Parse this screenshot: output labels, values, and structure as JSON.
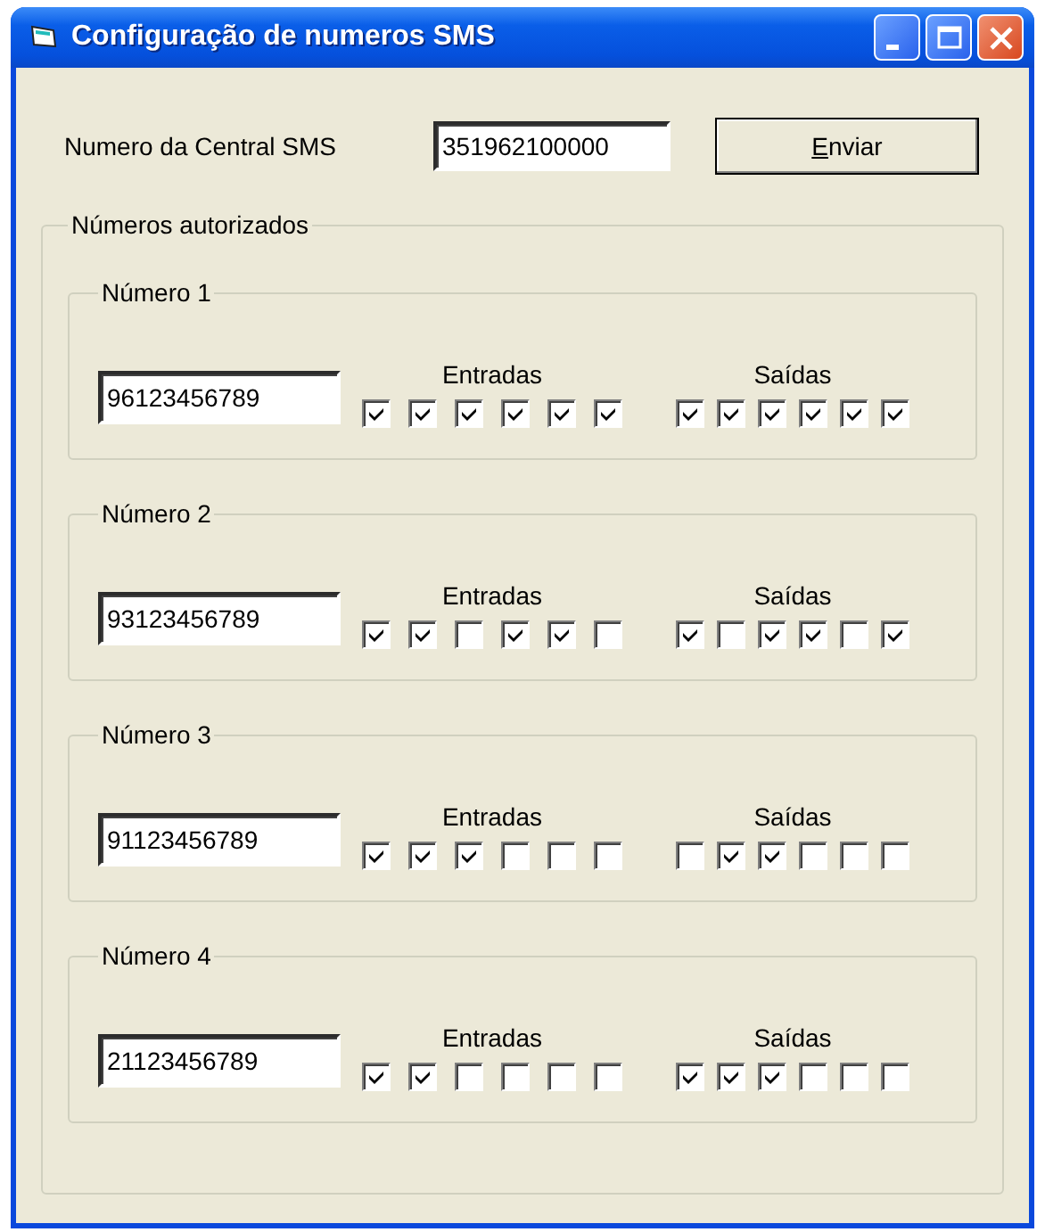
{
  "window": {
    "title": "Configuração de numeros SMS"
  },
  "central": {
    "label": "Numero da Central SMS",
    "value": "351962100000",
    "button": "Enviar"
  },
  "authorized": {
    "title": "Números autorizados",
    "groups": [
      {
        "title": "Número 1",
        "number": "96123456789",
        "columns": [
          {
            "label": "Entradas",
            "checkboxes": [
              {
                "checked": true
              },
              {
                "checked": true
              },
              {
                "checked": true
              },
              {
                "checked": true
              },
              {
                "checked": true
              },
              {
                "checked": true
              }
            ]
          },
          {
            "label": "Saídas",
            "checkboxes": [
              {
                "checked": true
              },
              {
                "checked": true
              },
              {
                "checked": true
              },
              {
                "checked": true
              },
              {
                "checked": true
              },
              {
                "checked": true
              }
            ]
          }
        ]
      },
      {
        "title": "Número 2",
        "number": "93123456789",
        "columns": [
          {
            "label": "Entradas",
            "checkboxes": [
              {
                "checked": true
              },
              {
                "checked": true
              },
              {
                "checked": false
              },
              {
                "checked": true
              },
              {
                "checked": true
              },
              {
                "checked": false
              }
            ]
          },
          {
            "label": "Saídas",
            "checkboxes": [
              {
                "checked": true
              },
              {
                "checked": false
              },
              {
                "checked": true
              },
              {
                "checked": true
              },
              {
                "checked": false
              },
              {
                "checked": true
              }
            ]
          }
        ]
      },
      {
        "title": "Número 3",
        "number": "91123456789",
        "columns": [
          {
            "label": "Entradas",
            "checkboxes": [
              {
                "checked": true
              },
              {
                "checked": true
              },
              {
                "checked": true
              },
              {
                "checked": false
              },
              {
                "checked": false
              },
              {
                "checked": false
              }
            ]
          },
          {
            "label": "Saídas",
            "checkboxes": [
              {
                "checked": false
              },
              {
                "checked": true
              },
              {
                "checked": true
              },
              {
                "checked": false
              },
              {
                "checked": false
              },
              {
                "checked": false
              }
            ]
          }
        ]
      },
      {
        "title": "Número 4",
        "number": "21123456789",
        "columns": [
          {
            "label": "Entradas",
            "checkboxes": [
              {
                "checked": true
              },
              {
                "checked": true
              },
              {
                "checked": false
              },
              {
                "checked": false
              },
              {
                "checked": false
              },
              {
                "checked": false
              }
            ]
          },
          {
            "label": "Saídas",
            "checkboxes": [
              {
                "checked": true
              },
              {
                "checked": true
              },
              {
                "checked": true
              },
              {
                "checked": false
              },
              {
                "checked": false
              },
              {
                "checked": false
              }
            ]
          }
        ]
      }
    ]
  }
}
